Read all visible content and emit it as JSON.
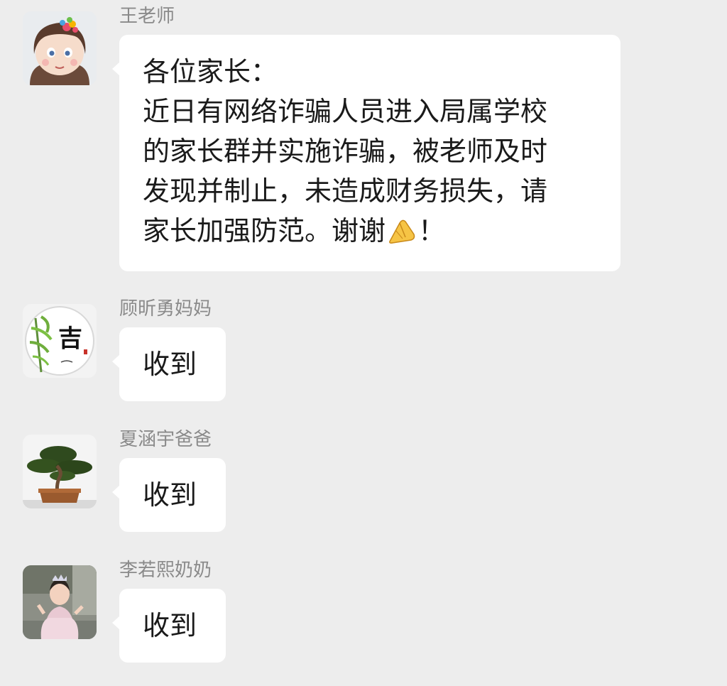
{
  "messages": [
    {
      "sender": "王老师",
      "avatar": "girl-with-flower-avatar",
      "lines": [
        "各位家长：",
        "近日有网络诈骗人员进入局属学校",
        "的家长群并实施诈骗，被老师及时",
        "发现并制止，未造成财务损失，请",
        "家长加强防范。谢谢"
      ],
      "tail": "！",
      "emoji": "praying-hands-emoji"
    },
    {
      "sender": "顾昕勇妈妈",
      "avatar": "bamboo-ji-calligraphy-avatar",
      "text": "收到"
    },
    {
      "sender": "夏涵宇爸爸",
      "avatar": "bonsai-tree-avatar",
      "text": "收到"
    },
    {
      "sender": "李若熙奶奶",
      "avatar": "little-girl-photo-avatar",
      "text": "收到"
    }
  ],
  "colors": {
    "background": "#ededed",
    "bubble": "#ffffff",
    "sender_name": "#8a8a8a",
    "message_text": "#1a1a1a"
  }
}
